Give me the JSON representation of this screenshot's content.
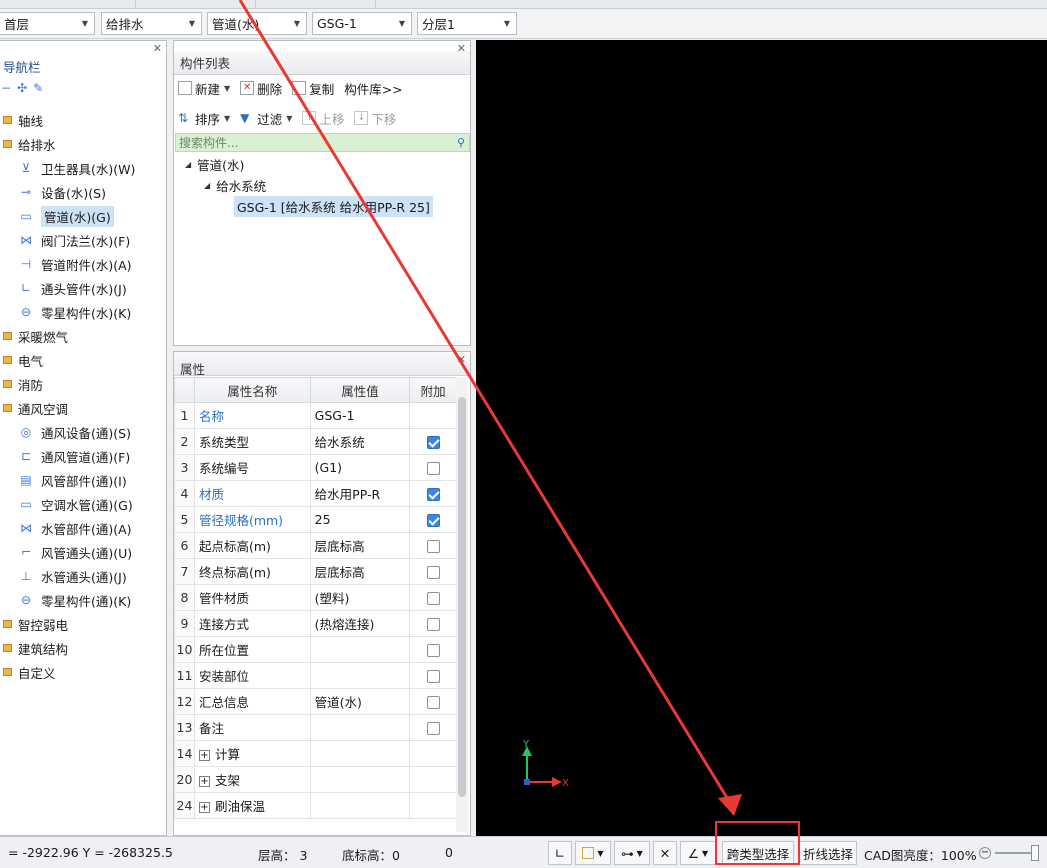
{
  "toolbar": {
    "floor": "首层",
    "specialty": "给排水",
    "component_type": "管道(水)",
    "component": "GSG-1",
    "layer": "分层1"
  },
  "nav": {
    "title": "导航栏",
    "groups": [
      {
        "label": "轴线"
      },
      {
        "label": "给排水"
      },
      {
        "label": "采暖燃气"
      },
      {
        "label": "电气"
      },
      {
        "label": "消防"
      },
      {
        "label": "通风空调"
      },
      {
        "label": "智控弱电"
      },
      {
        "label": "建筑结构"
      },
      {
        "label": "自定义"
      }
    ],
    "water_items": [
      {
        "label": "卫生器具(水)(W)",
        "icon": "toilet-icon"
      },
      {
        "label": "设备(水)(S)",
        "icon": "pump-icon"
      },
      {
        "label": "管道(水)(G)",
        "icon": "pipe-icon"
      },
      {
        "label": "阀门法兰(水)(F)",
        "icon": "valve-icon"
      },
      {
        "label": "管道附件(水)(A)",
        "icon": "pipe-fitting-icon"
      },
      {
        "label": "通头管件(水)(J)",
        "icon": "elbow-icon"
      },
      {
        "label": "零星构件(水)(K)",
        "icon": "misc-part-icon"
      }
    ],
    "hvac_items": [
      {
        "label": "通风设备(通)(S)",
        "icon": "fan-icon"
      },
      {
        "label": "通风管道(通)(F)",
        "icon": "duct-icon"
      },
      {
        "label": "风管部件(通)(I)",
        "icon": "duct-part-icon"
      },
      {
        "label": "空调水管(通)(G)",
        "icon": "ac-pipe-icon"
      },
      {
        "label": "水管部件(通)(A)",
        "icon": "water-part-icon"
      },
      {
        "label": "风管通头(通)(U)",
        "icon": "duct-elbow-icon"
      },
      {
        "label": "水管通头(通)(J)",
        "icon": "water-elbow-icon"
      },
      {
        "label": "零星构件(通)(K)",
        "icon": "misc-part-icon"
      }
    ]
  },
  "component_list": {
    "title": "构件列表",
    "buttons": {
      "new": "新建",
      "delete": "删除",
      "copy": "复制",
      "library": "构件库>>",
      "sort": "排序",
      "filter": "过滤",
      "move_up": "上移",
      "move_down": "下移"
    },
    "search_placeholder": "搜索构件...",
    "tree": {
      "root": "管道(水)",
      "system": "给水系统",
      "item": "GSG-1 [给水系统 给水用PP-R 25]"
    }
  },
  "properties": {
    "title": "属性",
    "headers": {
      "name": "属性名称",
      "value": "属性值",
      "extra": "附加"
    },
    "rows": [
      {
        "num": "1",
        "name": "名称",
        "value": "GSG-1"
      },
      {
        "num": "2",
        "name": "系统类型",
        "value": "给水系统"
      },
      {
        "num": "3",
        "name": "系统编号",
        "value": "(G1)"
      },
      {
        "num": "4",
        "name": "材质",
        "value": "给水用PP-R"
      },
      {
        "num": "5",
        "name": "管径规格(mm)",
        "value": "25"
      },
      {
        "num": "6",
        "name": "起点标高(m)",
        "value": "层底标高"
      },
      {
        "num": "7",
        "name": "终点标高(m)",
        "value": "层底标高"
      },
      {
        "num": "8",
        "name": "管件材质",
        "value": "(塑料)"
      },
      {
        "num": "9",
        "name": "连接方式",
        "value": "(热熔连接)"
      },
      {
        "num": "10",
        "name": "所在位置",
        "value": ""
      },
      {
        "num": "11",
        "name": "安装部位",
        "value": ""
      },
      {
        "num": "12",
        "name": "汇总信息",
        "value": "管道(水)"
      },
      {
        "num": "13",
        "name": "备注",
        "value": ""
      },
      {
        "num": "14",
        "name": "计算",
        "value": ""
      },
      {
        "num": "20",
        "name": "支架",
        "value": ""
      },
      {
        "num": "24",
        "name": "刷油保温",
        "value": ""
      }
    ],
    "checked": [
      2,
      4,
      5
    ]
  },
  "canvas": {
    "axis_y": "Y",
    "axis_x": "X"
  },
  "status": {
    "coords": "= -2922.96 Y = -268325.5",
    "floor_height": "层高：  3",
    "base_elevation": "底标高：0",
    "zero": "0",
    "cross_type_select": "跨类型选择",
    "polyline_select": "折线选择",
    "cad_brightness": "CAD图亮度：100%"
  },
  "colors": {
    "highlight": "#e83a32",
    "selection": "#cde1f7",
    "search_bg": "#d9f0d3",
    "check_on": "#3a86e0",
    "link_blue": "#2b6fc4"
  }
}
